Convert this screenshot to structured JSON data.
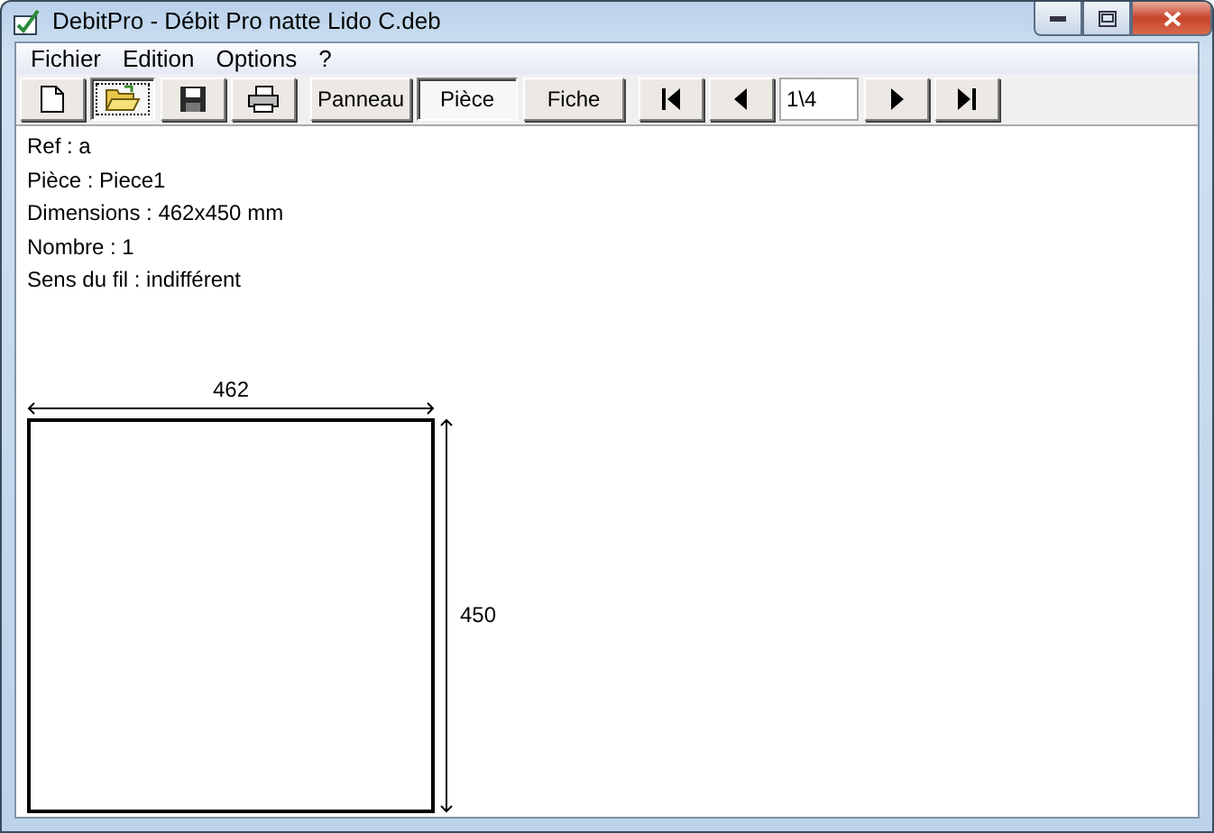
{
  "window": {
    "title": "DebitPro - Débit Pro natte Lido C.deb"
  },
  "menu": [
    {
      "label": "Fichier"
    },
    {
      "label": "Edition"
    },
    {
      "label": "Options"
    },
    {
      "label": "?"
    }
  ],
  "toolbar": [
    {
      "kind": "new",
      "selected": false
    },
    {
      "kind": "open",
      "selected": true
    },
    {
      "kind": "save",
      "selected": false
    },
    {
      "kind": "print",
      "selected": false
    },
    {
      "kind": "text",
      "label": "Panneau",
      "selected": false
    },
    {
      "kind": "text",
      "label": "Pièce",
      "selected": true
    },
    {
      "kind": "text",
      "label": "Fiche",
      "selected": false
    },
    {
      "kind": "first",
      "selected": false
    },
    {
      "kind": "prev",
      "selected": false
    },
    {
      "kind": "field",
      "value": "1\\4"
    },
    {
      "kind": "next",
      "selected": false
    },
    {
      "kind": "last",
      "selected": false
    }
  ],
  "info": [
    "Ref : a",
    "Pièce : Piece1",
    "Dimensions : 462x450 mm",
    "Nombre : 1",
    "Sens du fil : indifférent"
  ],
  "drawing": {
    "width_label": "462",
    "height_label": "450"
  }
}
